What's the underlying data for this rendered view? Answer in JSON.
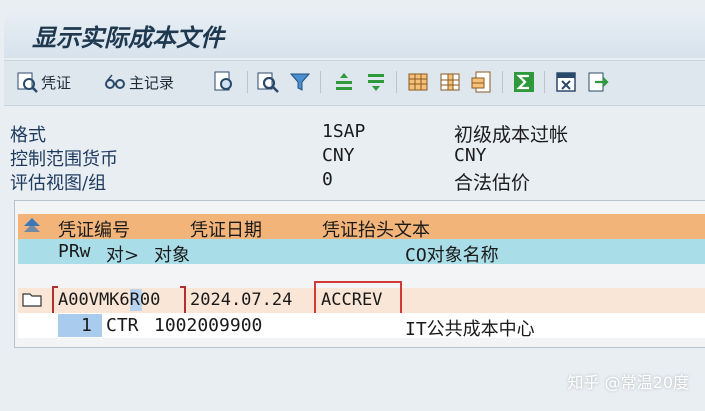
{
  "window": {
    "title": "显示实际成本文件"
  },
  "toolbar": {
    "voucher_label": "凭证",
    "master_record_label": "主记录"
  },
  "header": [
    {
      "label": "格式",
      "value": "1SAP",
      "desc": "初级成本过帐"
    },
    {
      "label": "控制范围货币",
      "value": "CNY",
      "desc": "CNY"
    },
    {
      "label": "评估视图/组",
      "value": "0",
      "desc": "合法估价"
    }
  ],
  "table": {
    "header_row1": {
      "doc_no": "凭证编号",
      "doc_date": "凭证日期",
      "header_text": "凭证抬头文本"
    },
    "header_row2": {
      "prw": "PRw",
      "obj_type": "对>",
      "object": "对象",
      "co_obj_name": "CO对象名称"
    },
    "doc_row": {
      "doc_no": "A00VMK6R00",
      "doc_date": "2024.07.24",
      "header_text": "ACCREV"
    },
    "item_row": {
      "prw": "1",
      "obj_type": "CTR",
      "object": "1002009900",
      "co_obj_name": "IT公共成本中心"
    }
  },
  "watermark": "知乎 @常温20度",
  "colors": {
    "header_orange": "#f2b479",
    "header_cyan": "#a9dde8",
    "highlight_red": "#d23a3a"
  }
}
